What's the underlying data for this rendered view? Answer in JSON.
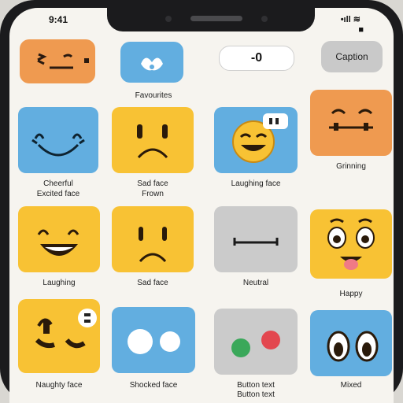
{
  "status": {
    "time": "9:41",
    "right_top": "•ıll ≋",
    "right_bottom": "■"
  },
  "top_row": {
    "pill_label": "-0",
    "grey_button_label": "Caption",
    "blue_tile_label": "Favourites"
  },
  "grid": [
    {
      "label_1": "Cheerful",
      "label_2": "Excited face"
    },
    {
      "label_1": "Sad face",
      "label_2": "Frown"
    },
    {
      "label_1": "Laughing face",
      "label_2": ""
    },
    {
      "label_1": "Grinning",
      "label_2": ""
    },
    {
      "label_1": "Laughing",
      "label_2": ""
    },
    {
      "label_1": "Sad face",
      "label_2": ""
    },
    {
      "label_1": "Neutral",
      "label_2": ""
    },
    {
      "label_1": "Happy",
      "label_2": ""
    },
    {
      "label_1": "Naughty face",
      "label_2": ""
    },
    {
      "label_1": "Shocked face",
      "label_2": ""
    },
    {
      "label_1": "Button text",
      "label_2": "Button text"
    },
    {
      "label_1": "Mixed",
      "label_2": ""
    }
  ],
  "colors": {
    "orange": "#ef9a50",
    "blue": "#62aee0",
    "yellow": "#f8c234",
    "grey": "#cbcbcb",
    "red": "#e3474f",
    "green": "#3aa85a"
  }
}
